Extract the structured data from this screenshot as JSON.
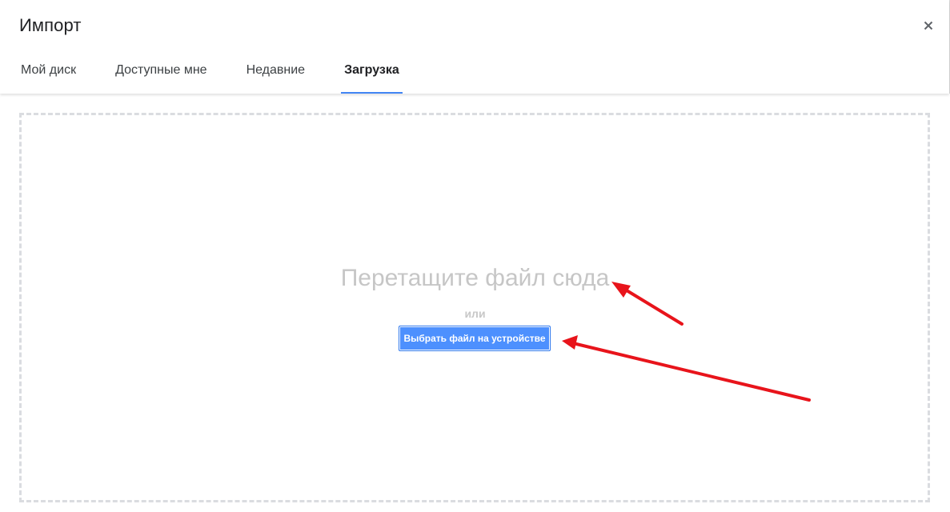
{
  "dialog": {
    "title": "Импорт",
    "close_icon": "close-icon"
  },
  "tabs": [
    {
      "label": "Мой диск",
      "active": false
    },
    {
      "label": "Доступные мне",
      "active": false
    },
    {
      "label": "Недавние",
      "active": false
    },
    {
      "label": "Загрузка",
      "active": true
    }
  ],
  "upload": {
    "drop_text": "Перетащите файл сюда",
    "or_text": "или",
    "button_label": "Выбрать файл на устройстве"
  },
  "colors": {
    "accent": "#4285f4",
    "button": "#4d90fe",
    "annotation_arrow": "#e8141b"
  }
}
